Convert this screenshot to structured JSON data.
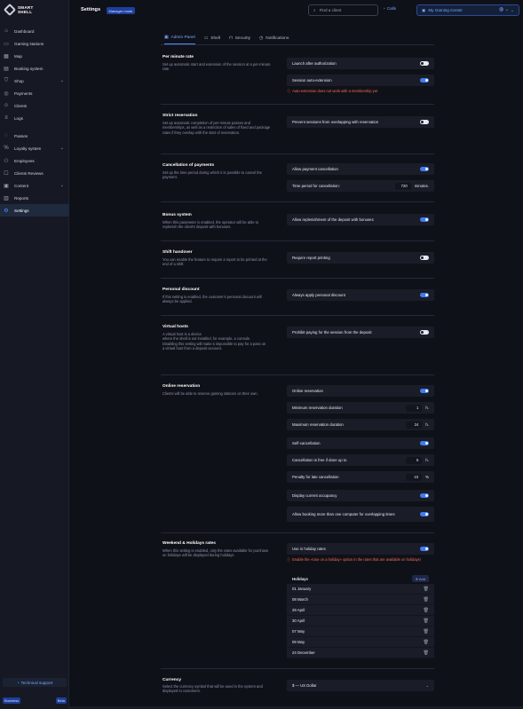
{
  "brand": {
    "line1": "SMART",
    "line2": "SHELL"
  },
  "sidebar": {
    "items": [
      {
        "label": "Dashboard",
        "icon": "home-icon"
      },
      {
        "label": "Gaming stations",
        "icon": "monitor-icon"
      },
      {
        "label": "Map",
        "icon": "map-icon"
      },
      {
        "label": "Booking system",
        "icon": "calendar-icon"
      },
      {
        "label": "Shop",
        "icon": "cart-icon",
        "expandable": true
      },
      {
        "label": "Payments",
        "icon": "coin-icon"
      },
      {
        "label": "Clients",
        "icon": "user-icon"
      },
      {
        "label": "Logs",
        "icon": "list-icon"
      },
      {
        "label": "Passes",
        "icon": "pass-icon"
      },
      {
        "label": "Loyalty system",
        "icon": "percent-icon",
        "expandable": true
      },
      {
        "label": "Employees",
        "icon": "team-icon"
      },
      {
        "label": "Clients Reviews",
        "icon": "review-icon"
      },
      {
        "label": "Content",
        "icon": "content-icon",
        "expandable": true
      },
      {
        "label": "Reports",
        "icon": "chart-icon"
      },
      {
        "label": "Settings",
        "icon": "gear-icon",
        "active": true
      }
    ],
    "support": "Technical support",
    "footer_left": "Business",
    "footer_right": "Beta"
  },
  "header": {
    "title": "Settings",
    "mode_badge": "Manager mode",
    "search_placeholder": "Find a client",
    "calls": "Calls",
    "center": "My Gaming Center"
  },
  "tabs": [
    {
      "label": "Admin Panel",
      "active": true
    },
    {
      "label": "Shell"
    },
    {
      "label": "Security"
    },
    {
      "label": "Notifications"
    }
  ],
  "sections": {
    "per_minute": {
      "title": "Per minute rate",
      "desc": "Set up automatic start and extension of the session at a per-minute rate.",
      "launch": "Launch after authorization",
      "auto_ext": "Session auto-extension",
      "warning": "Auto-extension does not work with a membership yet"
    },
    "strict": {
      "title": "Strict reservation",
      "desc": "Set up automatic completion of per-minute passes and memberships, as well as a restriction of sales of fixed and package rates if they overlap with the start of reservation.",
      "prevent": "Prevent sessions from overlapping with reservation"
    },
    "cancel": {
      "title": "Cancellation of payments",
      "desc": "Set up the time period during which it is possible to cancel the payment.",
      "allow": "Allow payment cancellation",
      "period_label": "Time period for cancellation:",
      "period_value": "720",
      "period_unit": "minutes."
    },
    "bonus": {
      "title": "Bonus system",
      "desc": "When this parameter is enabled, the operator will be able to replenish the client's deposit with bonuses.",
      "allow": "Allow replenishment of the deposit with bonuses"
    },
    "shift": {
      "title": "Shift handover",
      "desc": "You can enable the feature to require a report to be printed at the end of a shift.",
      "require": "Require report printing"
    },
    "personal": {
      "title": "Personal discount",
      "desc": "If this setting is enabled, the customer's personal discount will always be applied.",
      "always": "Always apply personal discount"
    },
    "virtual": {
      "title": "Virtual hosts",
      "desc1": "A virtual host is a device",
      "desc2": "where the shell is not installed, for example, a console.",
      "desc3": "Disabling this setting will make it impossible to pay for a pass on",
      "desc4": "a virtual host from a deposit account.",
      "prohibit": "Prohibit paying for the session from the deposit"
    },
    "online": {
      "title": "Online reservation",
      "desc": "Clients will be able to reserve gaming stations on their own.",
      "online": "Online reservation",
      "min_label": "Minimum reservation duration",
      "min_value": "1",
      "max_label": "Maximum reservation duration",
      "max_value": "24",
      "hour_unit": "h.",
      "self_cancel": "Self-cancellation",
      "free_label": "Cancellation is free if done up to",
      "free_value": "5",
      "penalty_label": "Penalty for late cancellation",
      "penalty_value": "10",
      "percent_unit": "%",
      "occupancy": "Display current occupancy",
      "booking_more": "Allow booking more than one computer for overlapping times"
    },
    "holidays": {
      "title": "Weekend & Holidays rates",
      "desc": "When this setting is enabled, only the rates available for purchase on holidays will be displayed during holidays.",
      "use": "Use in holiday rates",
      "warning": "Enable the «Use on a holiday» option in the rates that are available on holidays!",
      "list_title": "Holidays",
      "add": "Add",
      "dates": [
        "01 January",
        "08 March",
        "29 April",
        "30 April",
        "07 May",
        "09 May",
        "24 December"
      ]
    },
    "currency": {
      "title": "Currency",
      "desc": "Select the currency symbol that will be used in the system and displayed to customers.",
      "value": "$ — US Dollar"
    }
  },
  "colors": {
    "accent": "#3f7cf0",
    "warning": "#ff6b4a",
    "bg": "#0f1119",
    "panel": "#1a1d28"
  }
}
